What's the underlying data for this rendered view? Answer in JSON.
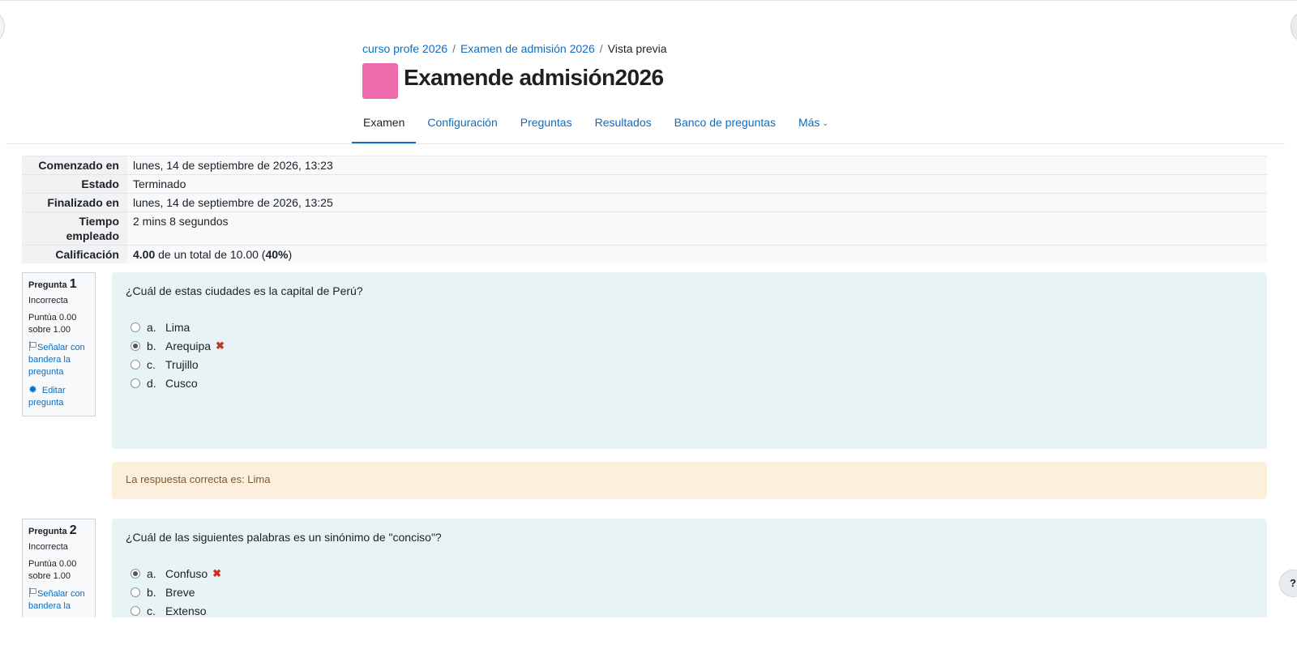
{
  "breadcrumb": {
    "items": [
      "curso profe 2026",
      "Examen de admisión 2026"
    ],
    "separator": "/",
    "current": "Vista previa"
  },
  "page": {
    "title": "Examende admisión2026",
    "icon_color": "#ee6aaa"
  },
  "nav": {
    "tabs": [
      "Examen",
      "Configuración",
      "Preguntas",
      "Resultados",
      "Banco de preguntas",
      "Más"
    ],
    "active": "Examen",
    "more_chevron": "⌄"
  },
  "summary": {
    "started_label": "Comenzado en",
    "started_value": "lunes, 14 de septiembre de 2026, 13:23",
    "state_label": "Estado",
    "state_value": "Terminado",
    "finished_label": "Finalizado en",
    "finished_value": "lunes, 14 de septiembre de 2026, 13:25",
    "time_label_1": "Tiempo",
    "time_label_2": "empleado",
    "time_value": "2 mins 8 segundos",
    "grade_label": "Calificación",
    "grade_score": "4.00",
    "grade_middle": "de un total de 10.00 (",
    "grade_percent": "40%",
    "grade_end": ")"
  },
  "q1": {
    "label": "Pregunta",
    "number": "1",
    "state": "Incorrecta",
    "grade_1": "Puntúa 0.00",
    "grade_2": "sobre 1.00",
    "flag": "Señalar con bandera la pregunta",
    "edit": "Editar pregunta",
    "text": "¿Cuál de estas ciudades es la capital de Perú?",
    "answers": [
      {
        "letter": "a.",
        "text": "Lima"
      },
      {
        "letter": "b.",
        "text": "Arequipa"
      },
      {
        "letter": "c.",
        "text": "Trujillo"
      },
      {
        "letter": "d.",
        "text": "Cusco"
      }
    ],
    "wrong_mark": "✖",
    "feedback": "La respuesta correcta es: Lima"
  },
  "q2": {
    "label": "Pregunta",
    "number": "2",
    "state": "Incorrecta",
    "grade_1": "Puntúa 0.00",
    "grade_2": "sobre 1.00",
    "flag": "Señalar con bandera la",
    "text": "¿Cuál de las siguientes palabras es un sinónimo de \"conciso\"?",
    "answers": [
      {
        "letter": "a.",
        "text": "Confuso"
      },
      {
        "letter": "b.",
        "text": "Breve"
      },
      {
        "letter": "c.",
        "text": "Extenso"
      }
    ],
    "wrong_mark": "✖"
  },
  "help": {
    "label": "?"
  },
  "colors": {
    "link": "#0f6cbf",
    "question_bg": "#e7f3f5",
    "feedback_bg": "#fcefdc",
    "wrong": "#ca3120"
  }
}
